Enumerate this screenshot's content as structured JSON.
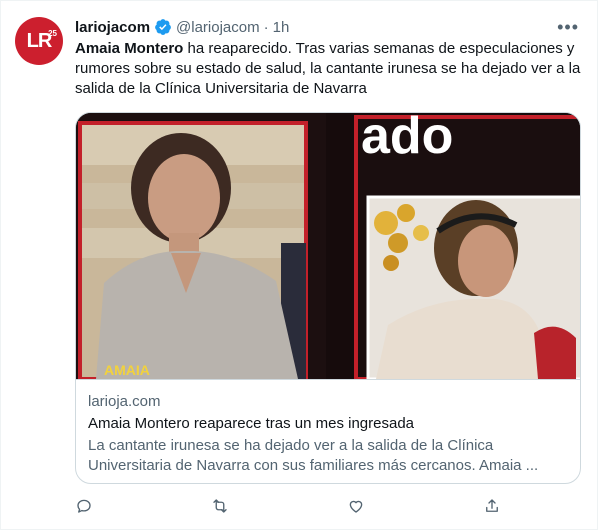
{
  "account": {
    "avatar_text": "LR",
    "avatar_badge": "25",
    "name": "lariojacom",
    "handle": "@lariojacom",
    "separator": "·",
    "time": "1h",
    "verified": true
  },
  "tweet": {
    "bold_lead": "Amaia Montero",
    "text": " ha reaparecido. Tras varias semanas de especulaciones y rumores sobre su estado de salud, la cantante irunesa se ha dejado ver a la salida de la Clínica Universitaria de Navarra"
  },
  "card": {
    "domain": "larioja.com",
    "title": "Amaia Montero reaparece tras un mes ingresada",
    "description": "La cantante irunesa se ha dejado ver a la salida de la Clínica Universitaria de Navarra con sus familiares más cercanos. Amaia ...",
    "image_caption_left": "AMAIA",
    "image_headline_right": "ado"
  },
  "actions": [
    {
      "name": "reply-icon"
    },
    {
      "name": "retweet-icon"
    },
    {
      "name": "like-icon"
    },
    {
      "name": "share-icon"
    }
  ],
  "colors": {
    "brand_red": "#cc1f2e",
    "verified_blue": "#1d9bf0",
    "secondary_text": "#536471",
    "border": "#cfd9de"
  }
}
